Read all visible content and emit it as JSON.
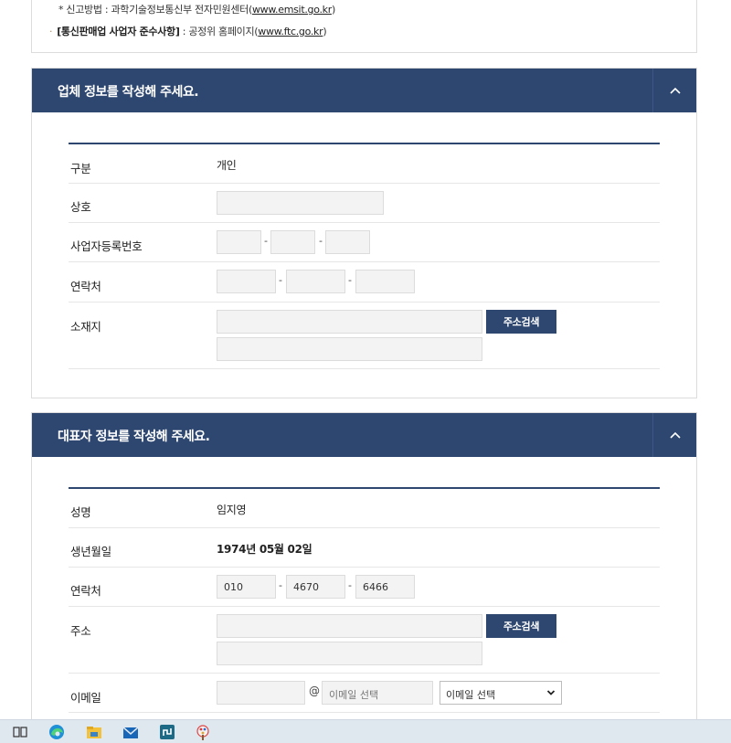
{
  "notice": {
    "line1_text": "* 신고방법 : 과학기술정보통신부 전자민원센터(",
    "line1_link": "www.emsit.go.kr",
    "line1_end": ")",
    "line2_bullet": "·",
    "line2_bold": "[통신판매업 사업자 준수사항]",
    "line2_text": " : 공정위 홈페이지(",
    "line2_link": "www.ftc.go.kr",
    "line2_end": ")"
  },
  "company": {
    "title": "업체 정보를 작성해 주세요.",
    "rows": {
      "type": {
        "label": "구분",
        "value": "개인"
      },
      "name": {
        "label": "상호"
      },
      "biz_no": {
        "label": "사업자등록번호",
        "sep": "-"
      },
      "contact": {
        "label": "연락처",
        "sep": "-"
      },
      "location": {
        "label": "소재지",
        "button": "주소검색"
      }
    }
  },
  "rep": {
    "title": "대표자 정보를 작성해 주세요.",
    "rows": {
      "name": {
        "label": "성명",
        "value": "임지영"
      },
      "birth": {
        "label": "생년월일",
        "value": "1974년 05월 02일"
      },
      "contact": {
        "label": "연락처",
        "sep": "-",
        "p1": "010",
        "p2": "4670",
        "p3": "6466"
      },
      "address": {
        "label": "주소",
        "button": "주소검색"
      },
      "email": {
        "label": "이메일",
        "at": "@",
        "domain_placeholder": "이메일 선택",
        "select_value": "이메일 선택"
      }
    }
  },
  "taskbar": {
    "icons": [
      "task-view-icon",
      "edge-browser-icon",
      "file-explorer-icon",
      "mail-icon",
      "app-icon",
      "paint-icon"
    ]
  },
  "colors": {
    "header": "#2e4770",
    "input_bg": "#f3f3f3"
  }
}
